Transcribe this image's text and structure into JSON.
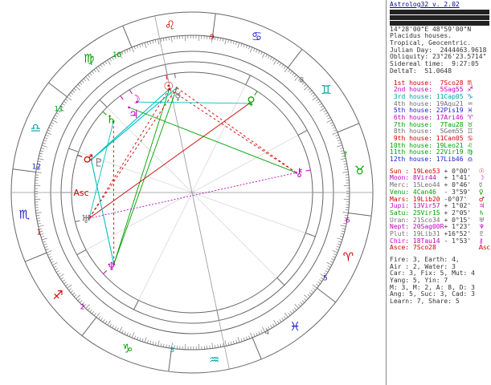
{
  "header": {
    "title": "Astrolog32 v. 2.02",
    "coords": "14°28'00\"E 48°59'00\"N",
    "system": "Placidus houses.",
    "zodiac": "Tropical, Geocentric.",
    "julian_day": "Julian Day:  2444463.9618",
    "obliquity": "Obliquity: 23°26'23.5714\"",
    "sidereal": "Sidereal time:  9:27:05",
    "deltat": "DeltaT:  51.0648"
  },
  "houses": [
    {
      "label": "1st house:",
      "value": "7Sco28",
      "glyph": "♏",
      "color": "#d00000"
    },
    {
      "label": "2nd house:",
      "value": "5Sag55",
      "glyph": "♐",
      "color": "#c000c0"
    },
    {
      "label": "3rd house:",
      "value": "11Cap05",
      "glyph": "♑",
      "color": "#00a0a0"
    },
    {
      "label": "4th house:",
      "value": "19Aqu21",
      "glyph": "♒",
      "color": "#707070"
    },
    {
      "label": "5th house:",
      "value": "22Pis19",
      "glyph": "♓",
      "color": "#2020d0"
    },
    {
      "label": "6th house:",
      "value": "17Ari46",
      "glyph": "♈",
      "color": "#c000c0"
    },
    {
      "label": "7th house:",
      "value": "7Tau28",
      "glyph": "♉",
      "color": "#00a000"
    },
    {
      "label": "8th house:",
      "value": "5Gem55",
      "glyph": "♊",
      "color": "#707070"
    },
    {
      "label": "9th house:",
      "value": "11Can05",
      "glyph": "♋",
      "color": "#d00000"
    },
    {
      "label": "10th house:",
      "value": "19Leo21",
      "glyph": "♌",
      "color": "#00a000"
    },
    {
      "label": "11th house:",
      "value": "22Vir19",
      "glyph": "♍",
      "color": "#00a000"
    },
    {
      "label": "12th house:",
      "value": "17Lib46",
      "glyph": "♎",
      "color": "#2020d0"
    }
  ],
  "planets": [
    {
      "label": "Sun :",
      "value": "19Leo53",
      "speed": "+ 0°00'",
      "glyph": "☉",
      "color": "#d00000"
    },
    {
      "label": "Moon:",
      "value": "8Vir44",
      "speed": "+ 1°41'",
      "glyph": "☽",
      "color": "#c000c0"
    },
    {
      "label": "Merc:",
      "value": "15Leo44",
      "speed": "+ 0°46'",
      "glyph": "☿",
      "color": "#707070"
    },
    {
      "label": "Venu:",
      "value": "4Can46",
      "speed": "- 3°59'",
      "glyph": "♀",
      "color": "#00a000"
    },
    {
      "label": "Mars:",
      "value": "19Lib20",
      "speed": "-0°07'",
      "glyph": "♂",
      "color": "#d00000"
    },
    {
      "label": "Jupi:",
      "value": "13Vir57",
      "speed": "+ 1°02'",
      "glyph": "♃",
      "color": "#c000c0"
    },
    {
      "label": "Satu:",
      "value": "25Vir15",
      "speed": "+ 2°05'",
      "glyph": "♄",
      "color": "#00a000"
    },
    {
      "label": "Uran:",
      "value": "21Sco34",
      "speed": "+ 0°15'",
      "glyph": "♅",
      "color": "#707070"
    },
    {
      "label": "Nept:",
      "value": "20Sag00R",
      "speed": "+ 1°23'",
      "glyph": "♆",
      "color": "#c000c0"
    },
    {
      "label": "Plut:",
      "value": "19Lib31",
      "speed": "+16°52'",
      "glyph": "♇",
      "color": "#707070"
    },
    {
      "label": "Chir:",
      "value": "18Tau14",
      "speed": "- 1°53'",
      "glyph": "⚷",
      "color": "#c000c0"
    },
    {
      "label": "Asce:",
      "value": "7Sco28",
      "speed": "",
      "glyph": "Asc",
      "color": "#d00000"
    }
  ],
  "summary": [
    "Fire: 3, Earth: 4,",
    "Air : 2, Water: 3",
    "Car: 3, Fix: 5, Mut: 4",
    "Yang: 5, Yin: 7",
    "M: 3, M: 2, A: 8, D: 3",
    "Ang: 5, Suc: 3, Cad: 3",
    "Learn: 7, Share: 5"
  ],
  "wheel": {
    "signs": [
      {
        "glyph": "♈",
        "color": "#d00000"
      },
      {
        "glyph": "♉",
        "color": "#00a000"
      },
      {
        "glyph": "♊",
        "color": "#00a0a0"
      },
      {
        "glyph": "♋",
        "color": "#2020d0"
      },
      {
        "glyph": "♌",
        "color": "#d00000"
      },
      {
        "glyph": "♍",
        "color": "#00a000"
      },
      {
        "glyph": "♎",
        "color": "#00a0a0"
      },
      {
        "glyph": "♏",
        "color": "#2020d0"
      },
      {
        "glyph": "♐",
        "color": "#d00000"
      },
      {
        "glyph": "♑",
        "color": "#00a000"
      },
      {
        "glyph": "♒",
        "color": "#00a0a0"
      },
      {
        "glyph": "♓",
        "color": "#2020d0"
      }
    ],
    "house_numbers": [
      "1",
      "2",
      "3",
      "4",
      "5",
      "6",
      "7",
      "8",
      "9",
      "10",
      "11",
      "12"
    ],
    "house_cusps_deg": [
      217.47,
      245.92,
      281.08,
      319.35,
      352.32,
      17.77,
      37.47,
      65.92,
      101.08,
      139.35,
      172.32,
      197.77
    ],
    "planets": [
      {
        "glyph": "☉",
        "lon": 139.88,
        "color": "#d00000"
      },
      {
        "glyph": "☽",
        "lon": 158.73,
        "color": "#c000c0"
      },
      {
        "glyph": "☿",
        "lon": 135.73,
        "color": "#707070"
      },
      {
        "glyph": "♀",
        "lon": 94.77,
        "color": "#00a000"
      },
      {
        "glyph": "♂",
        "lon": 199.33,
        "color": "#d00000"
      },
      {
        "glyph": "♃",
        "lon": 163.95,
        "color": "#c000c0"
      },
      {
        "glyph": "♄",
        "lon": 175.25,
        "color": "#00a000"
      },
      {
        "glyph": "♅",
        "lon": 231.57,
        "color": "#707070"
      },
      {
        "glyph": "♆",
        "lon": 260.0,
        "color": "#c000c0"
      },
      {
        "glyph": "♇",
        "lon": 199.52,
        "color": "#707070"
      },
      {
        "glyph": "⚷",
        "lon": 48.23,
        "color": "#c000c0"
      }
    ],
    "asc_label": "Asc"
  }
}
